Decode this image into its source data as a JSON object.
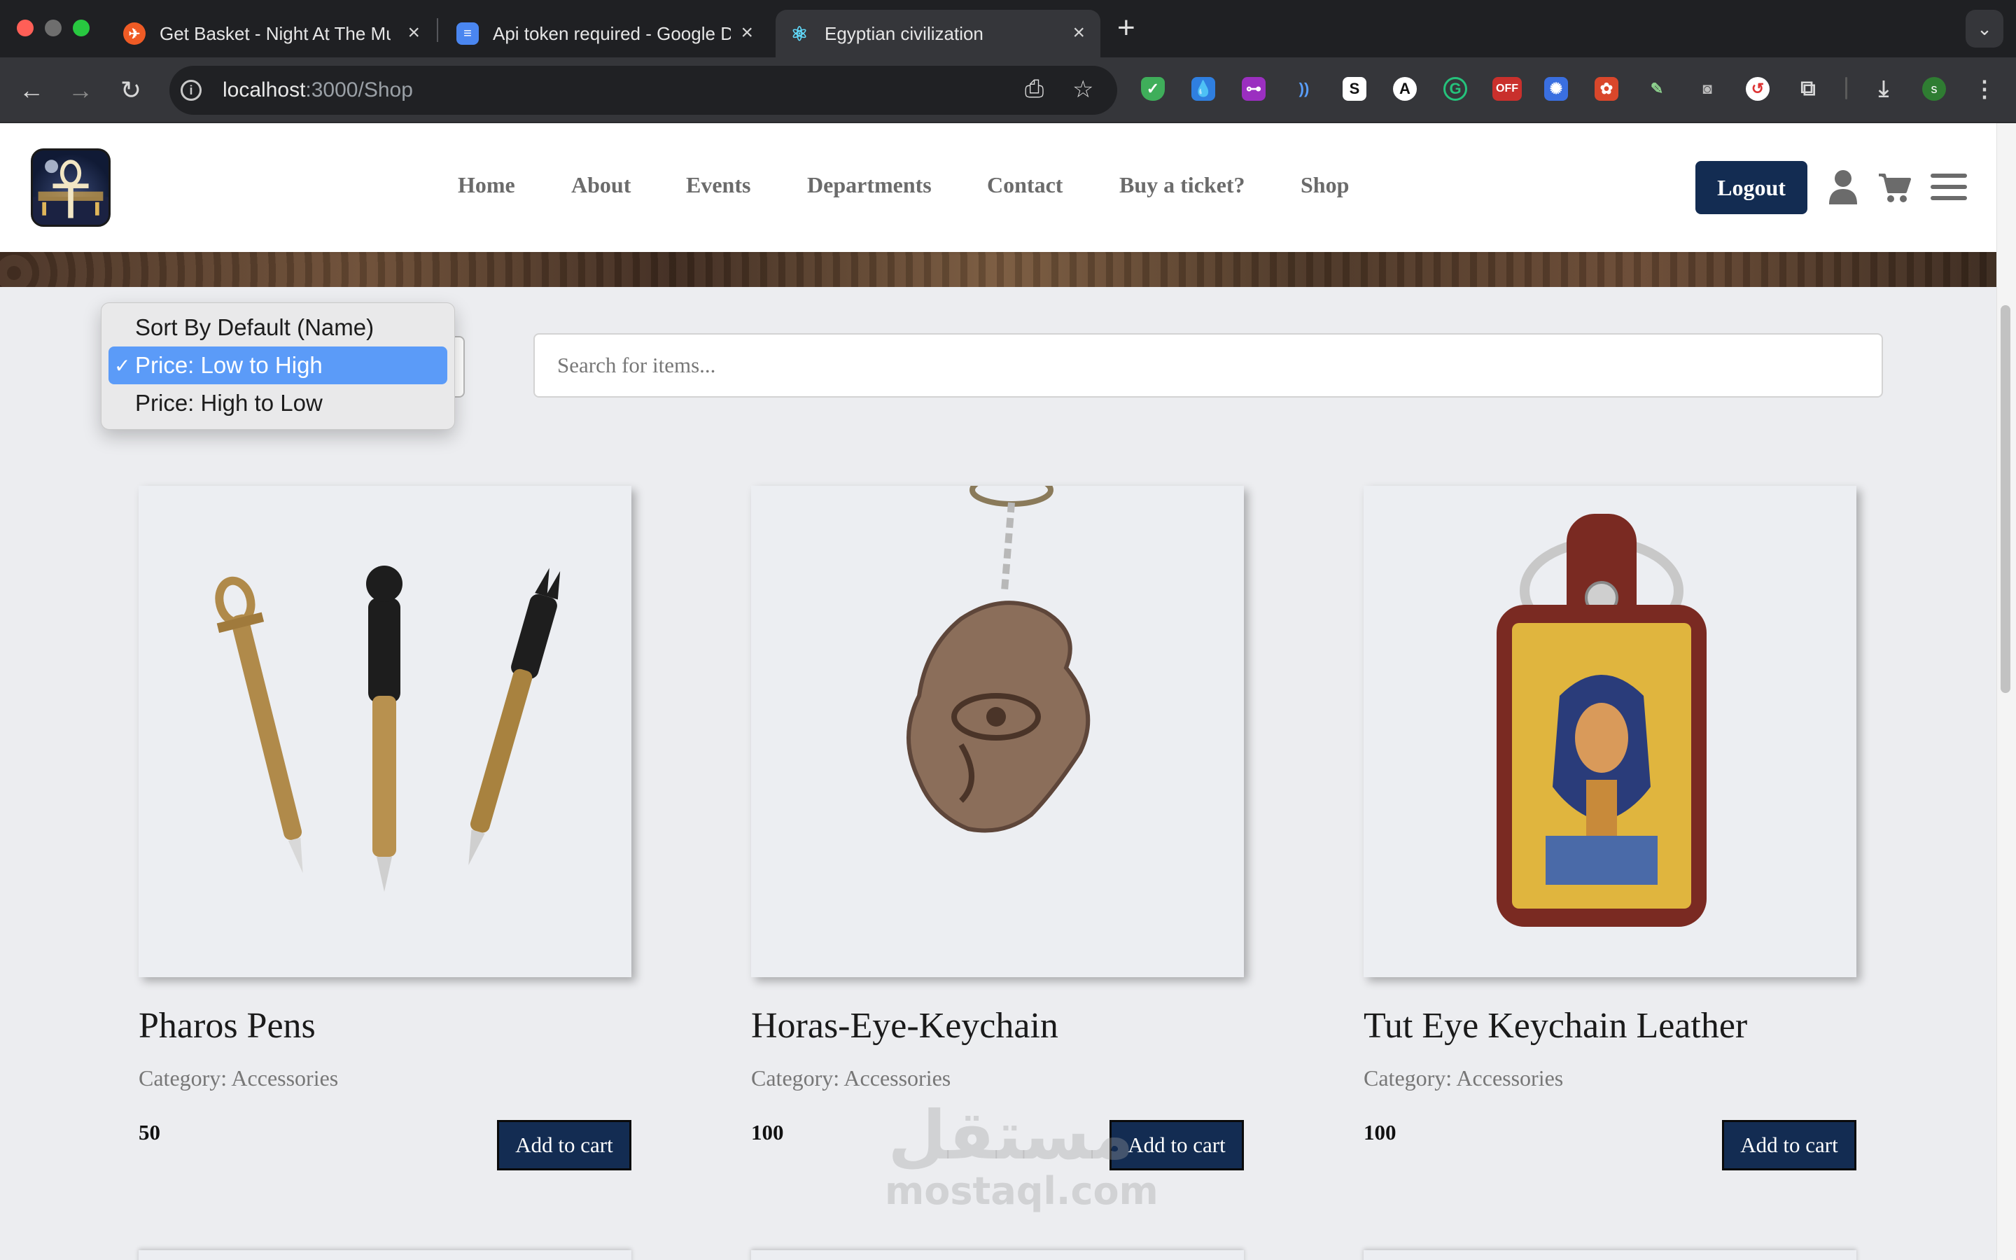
{
  "browser": {
    "tabs": [
      {
        "title": "Get Basket - Night At The Mu",
        "favicon": "postman-icon",
        "active": false
      },
      {
        "title": "Api token required - Google D",
        "favicon": "google-docs-icon",
        "active": false
      },
      {
        "title": "Egyptian civilization",
        "favicon": "react-icon",
        "active": true
      }
    ],
    "url_host": "localhost",
    "url_path": ":3000/Shop",
    "colors": {
      "tabbar": "#1f2023",
      "toolbar": "#35363a",
      "omnibox": "#202124"
    },
    "extensions": [
      "adguard-icon",
      "drop-icon",
      "toggle-icon",
      "wave-icon",
      "s-icon",
      "a-icon",
      "grammarly-icon",
      "off-icon",
      "gear-icon",
      "puzzle-red-icon",
      "pen-icon",
      "camera-icon",
      "refresh-icon",
      "extensions-icon"
    ],
    "extension_badge": "OFF",
    "profile_initial": "s"
  },
  "header": {
    "nav": [
      "Home",
      "About",
      "Events",
      "Departments",
      "Contact",
      "Buy a ticket?",
      "Shop"
    ],
    "logout_label": "Logout",
    "colors": {
      "primary": "#132c52"
    }
  },
  "filters": {
    "sort_options": [
      "Sort By Default (Name)",
      "Price: Low to High",
      "Price: High to Low"
    ],
    "selected_index": 1,
    "check_mark": "✓",
    "search_placeholder": "Search for items..."
  },
  "products": [
    {
      "name": "Pharos Pens",
      "category": "Category: Accessories",
      "price": "50",
      "button": "Add to cart"
    },
    {
      "name": "Horas-Eye-Keychain",
      "category": "Category: Accessories",
      "price": "100",
      "button": "Add to cart"
    },
    {
      "name": "Tut Eye Keychain Leather",
      "category": "Category: Accessories",
      "price": "100",
      "button": "Add to cart"
    }
  ],
  "watermark": {
    "arabic": "مستقل",
    "latin": "mostaql.com"
  }
}
